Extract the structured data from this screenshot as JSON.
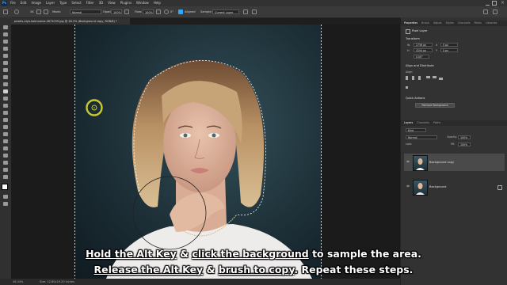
{
  "app": {
    "logo": "Ps"
  },
  "menu": [
    "File",
    "Edit",
    "Image",
    "Layer",
    "Type",
    "Select",
    "Filter",
    "3D",
    "View",
    "Plugins",
    "Window",
    "Help"
  ],
  "options": {
    "brush_size": "26",
    "mode_label": "Mode:",
    "mode_value": "Normal",
    "opacity_label": "Opacity:",
    "opacity_value": "100%",
    "flow_label": "Flow:",
    "flow_value": "100%",
    "angle_value": "0°",
    "aligned_label": "Aligned",
    "sample_label": "Sample:",
    "sample_value": "Current Layer"
  },
  "document": {
    "tab": "pexels-olya-kobruseva-4672039.jpg @ 46.3% (Background copy, RGB/8) *"
  },
  "status": {
    "zoom": "46.44%",
    "dims": "Size: 12.80x19.20 inches"
  },
  "panels": {
    "properties_tabs": [
      "Properties",
      "Brush",
      "Adjust",
      "Styles",
      "Channels",
      "Paths",
      "Libraries"
    ],
    "pixel_layer": "Pixel Layer",
    "transform_title": "Transform",
    "w_value": "2736 px",
    "h_value": "4104 px",
    "x_value": "0 px",
    "y_value": "0 px",
    "angle": "0.00°",
    "align_title": "Align and Distribute",
    "align_label": "Align:",
    "quick_actions": "Quick Actions",
    "remove_background": "Remove Background",
    "layers_tabs": [
      "Layers",
      "Channels",
      "Paths"
    ],
    "kind_label": "Kind",
    "blend_mode": "Normal",
    "opacity_label": "Opacity:",
    "opacity_value": "100%",
    "lock_label": "Lock:",
    "fill_label": "Fill:",
    "fill_value": "100%",
    "layers": [
      {
        "name": "Background copy"
      },
      {
        "name": "Background"
      }
    ]
  },
  "caption": {
    "line1_u1": "Hold the Alt Key",
    "line1_mid": " & ",
    "line1_u2": "click the background",
    "line1_end": " to sample the area.",
    "line2_u1": "Release the Alt Key",
    "line2_mid": " & ",
    "line2_u2": "brush to copy",
    "line2_end": ". Repeat these steps."
  },
  "colors": {
    "accent": "#31a8ff",
    "brush_cursor": "#c8c832",
    "bg": "#1e1e1e",
    "panel": "#323232"
  }
}
